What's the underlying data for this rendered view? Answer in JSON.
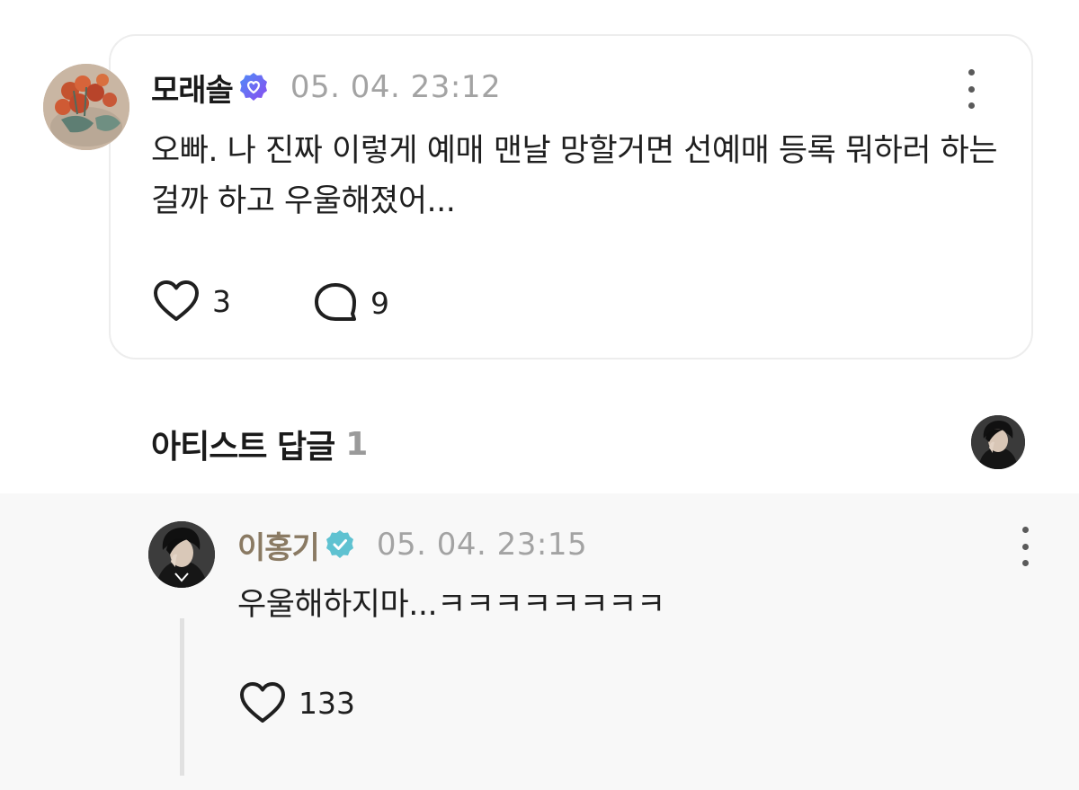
{
  "post": {
    "author": "모래솔",
    "verified_icon": "heart-badge-icon",
    "timestamp": "05. 04. 23:12",
    "body": "오빠. 나 진짜 이렇게 예매 맨날 망할거면 선예매 등록 뭐하러 하는걸까 하고 우울해졌어...",
    "like_count": "3",
    "comment_count": "9",
    "colors": {
      "badge": "#6b5cf6",
      "border": "#ededed"
    }
  },
  "artist_replies": {
    "title": "아티스트 답글",
    "count": "1"
  },
  "reply": {
    "author": "이홍기",
    "verified_icon": "verified-check-icon",
    "timestamp": "05. 04. 23:15",
    "body": "우울해하지마...ㅋㅋㅋㅋㅋㅋㅋㅋ",
    "like_count": "133",
    "colors": {
      "author": "#8a7a63",
      "badge": "#5fc2d1",
      "panel": "#f8f8f8"
    }
  }
}
